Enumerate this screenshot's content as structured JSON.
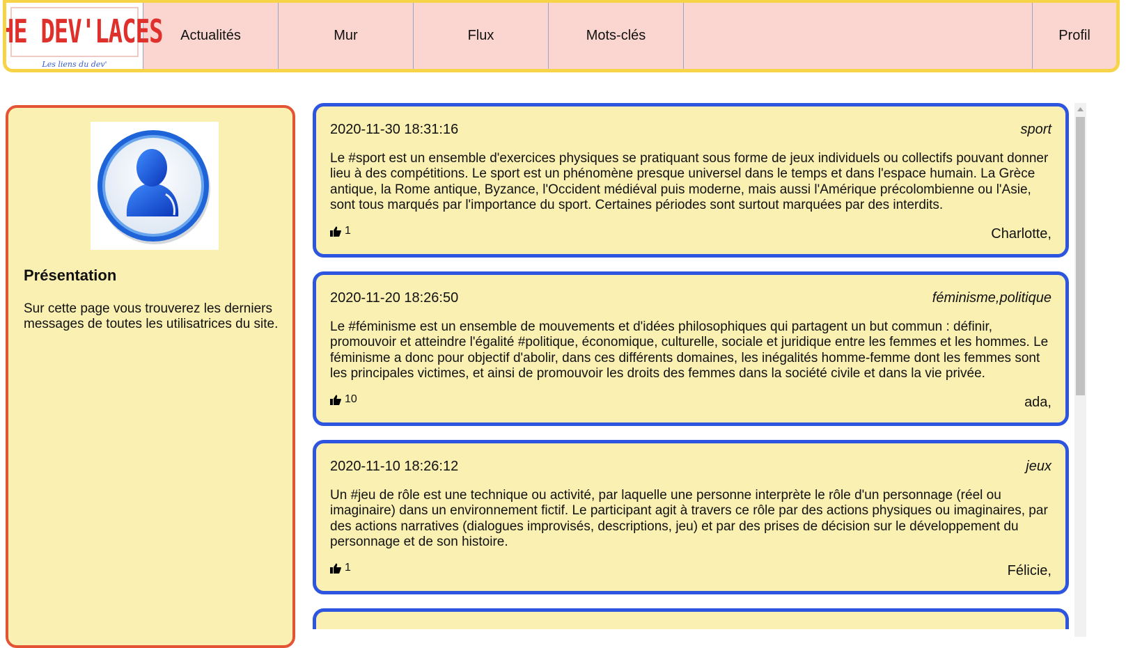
{
  "header": {
    "logo_text": "THE DEV'LACES",
    "logo_tagline": "Les liens du dev'",
    "nav": [
      "Actualités",
      "Mur",
      "Flux",
      "Mots-clés"
    ],
    "profile_label": "Profil"
  },
  "sidebar": {
    "avatar_icon": "user-avatar-icon",
    "title": "Présentation",
    "description": "Sur cette page vous trouverez les derniers messages de toutes les utilisatrices du site."
  },
  "posts": [
    {
      "date": "2020-11-30 18:31:16",
      "tags": "sport",
      "body": "Le #sport est un ensemble d'exercices physiques se pratiquant sous forme de jeux individuels ou collectifs pouvant donner lieu à des compétitions. Le sport est un phénomène presque universel dans le temps et dans l'espace humain. La Grèce antique, la Rome antique, Byzance, l'Occident médiéval puis moderne, mais aussi l'Amérique précolombienne ou l'Asie, sont tous marqués par l'importance du sport. Certaines périodes sont surtout marquées par des interdits.",
      "likes": "1",
      "author": "Charlotte,"
    },
    {
      "date": "2020-11-20 18:26:50",
      "tags": "féminisme,politique",
      "body": "Le #féminisme est un ensemble de mouvements et d'idées philosophiques qui partagent un but commun : définir, promouvoir et atteindre l'égalité #politique, économique, culturelle, sociale et juridique entre les femmes et les hommes. Le féminisme a donc pour objectif d'abolir, dans ces différents domaines, les inégalités homme-femme dont les femmes sont les principales victimes, et ainsi de promouvoir les droits des femmes dans la société civile et dans la vie privée.",
      "likes": "10",
      "author": "ada,"
    },
    {
      "date": "2020-11-10 18:26:12",
      "tags": "jeux",
      "body": "Un #jeu de rôle est une technique ou activité, par laquelle une personne interprète le rôle d'un personnage (réel ou imaginaire) dans un environnement fictif. Le participant agit à travers ce rôle par des actions physiques ou imaginaires, par des actions narratives (dialogues improvisés, descriptions, jeu) et par des prises de décision sur le développement du personnage et de son histoire.",
      "likes": "1",
      "author": "Félicie,"
    }
  ],
  "colors": {
    "header_border": "#f7d348",
    "header_bg": "#fbd6d0",
    "sidebar_border": "#e45334",
    "post_border": "#2e55e0",
    "panel_bg": "#faf0b2"
  },
  "icons": {
    "like": "thumbs-up-icon",
    "scroll": "scroll-up-arrow-icon"
  }
}
